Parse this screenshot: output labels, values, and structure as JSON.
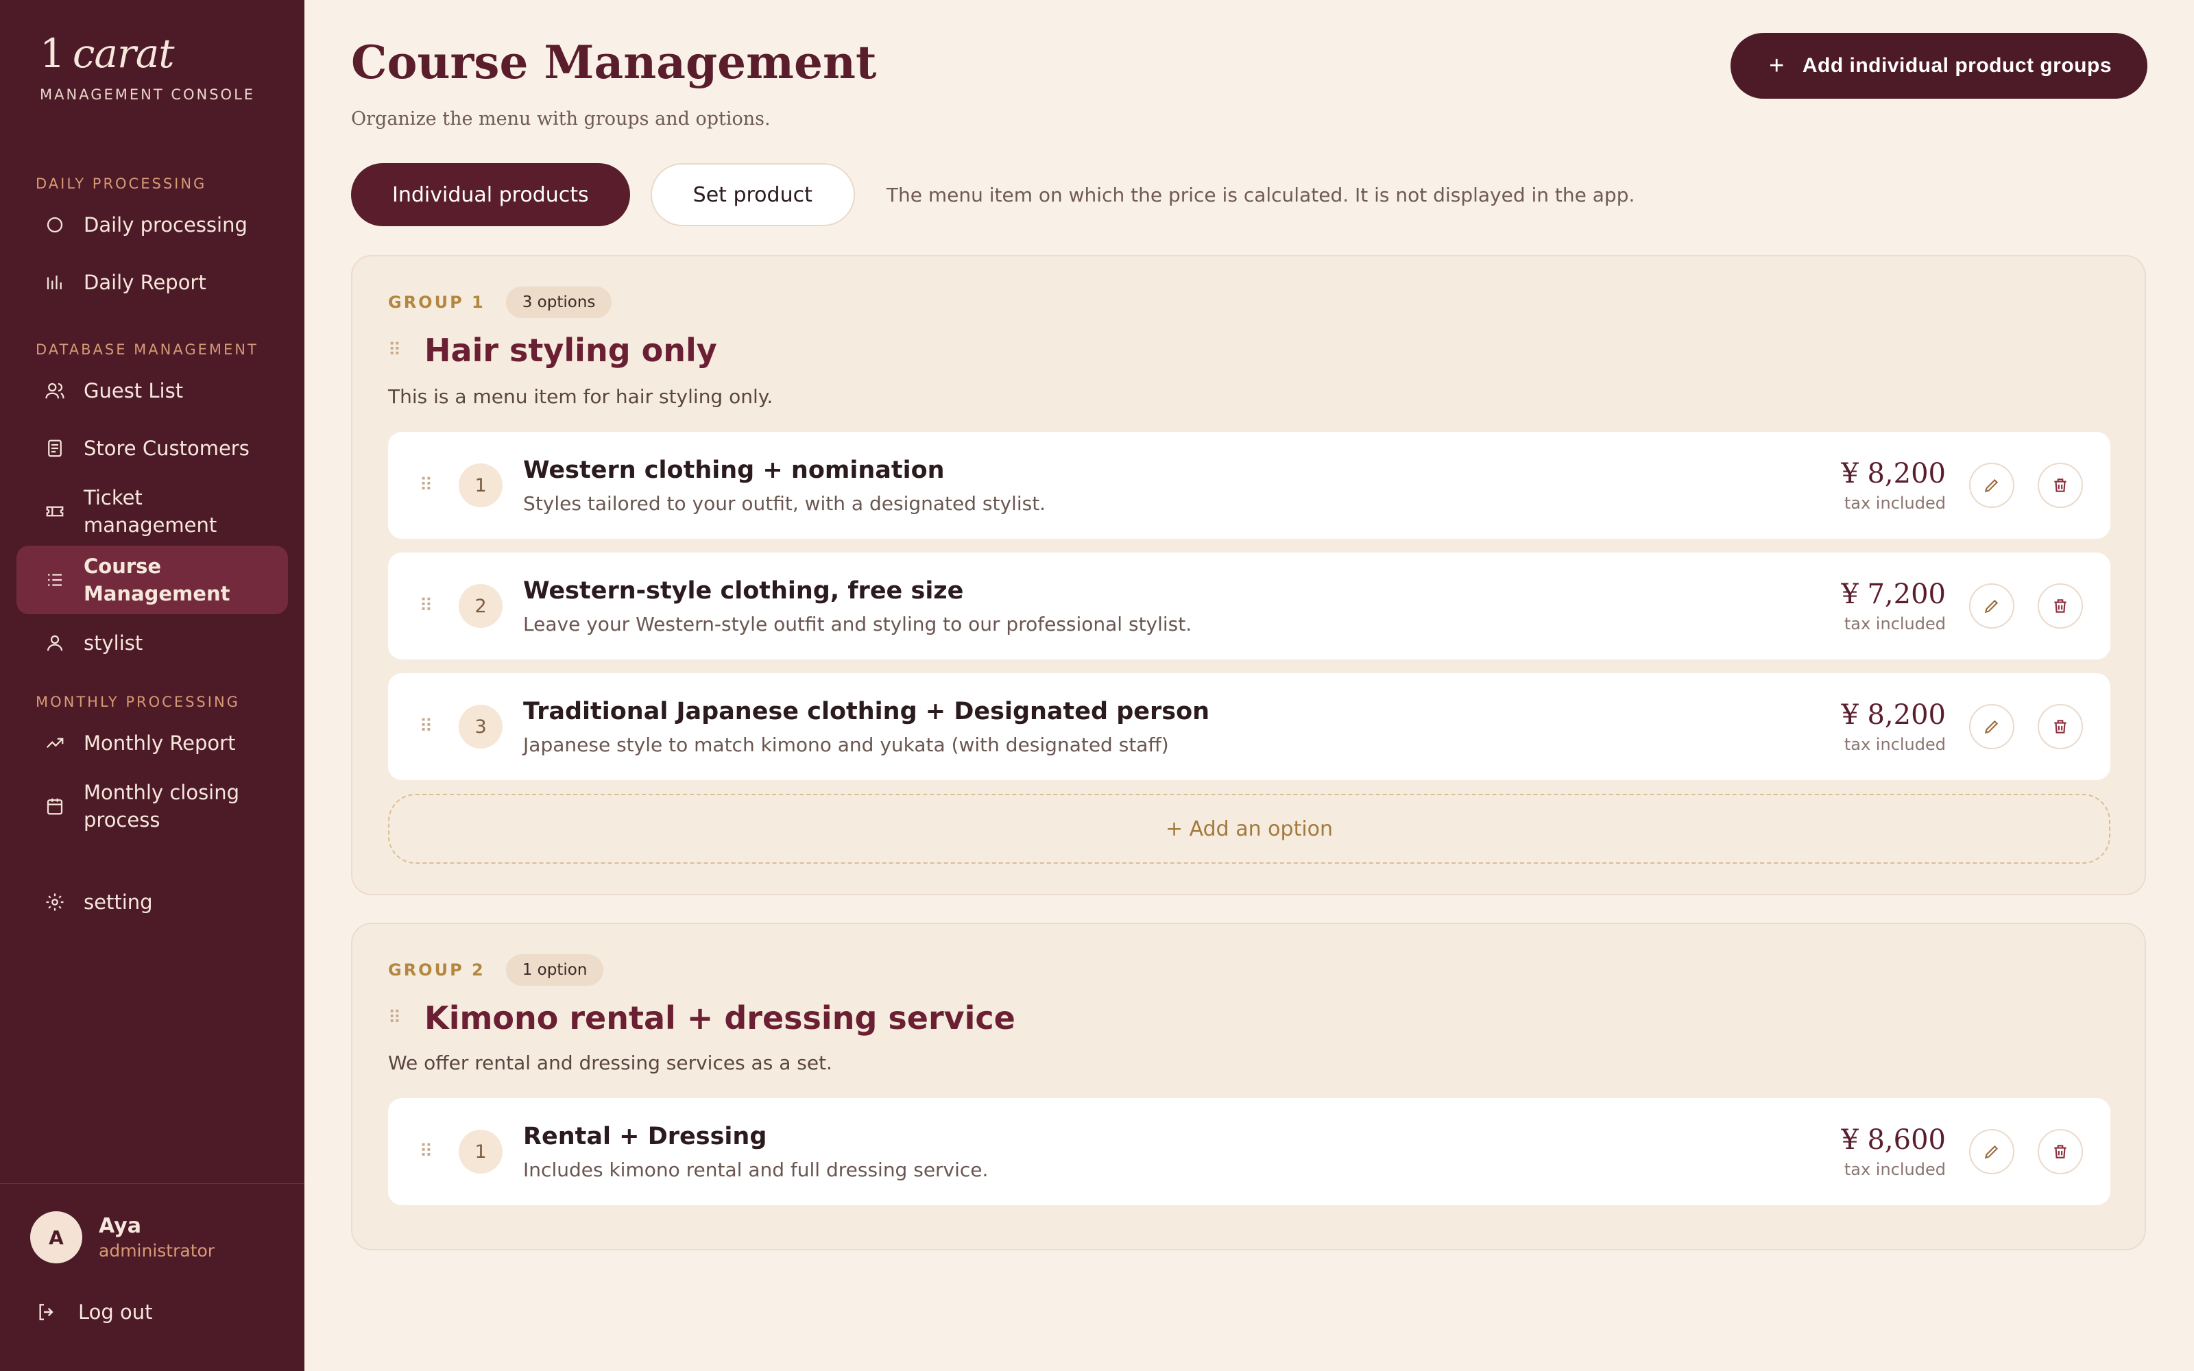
{
  "brand": {
    "logo_number": "1",
    "logo_word": "carat",
    "subtitle": "MANAGEMENT CONSOLE"
  },
  "sidebar": {
    "sections": [
      {
        "title": "DAILY PROCESSING",
        "items": [
          {
            "label": "Daily processing",
            "icon": "circle-icon"
          },
          {
            "label": "Daily Report",
            "icon": "bar-chart-icon"
          }
        ]
      },
      {
        "title": "DATABASE MANAGEMENT",
        "items": [
          {
            "label": "Guest List",
            "icon": "users-icon"
          },
          {
            "label": "Store Customers",
            "icon": "document-icon"
          },
          {
            "label": "Ticket management",
            "icon": "ticket-icon"
          },
          {
            "label": "Course Management",
            "icon": "list-icon",
            "active": true
          },
          {
            "label": "stylist",
            "icon": "user-icon"
          }
        ]
      },
      {
        "title": "MONTHLY PROCESSING",
        "items": [
          {
            "label": "Monthly Report",
            "icon": "trend-icon"
          },
          {
            "label": "Monthly closing process",
            "icon": "calendar-icon"
          }
        ]
      }
    ],
    "settings_label": "setting",
    "user": {
      "initial": "A",
      "name": "Aya",
      "role": "administrator"
    },
    "logout_label": "Log out"
  },
  "header": {
    "title": "Course Management",
    "subtitle": "Organize the menu with groups and options.",
    "add_button_label": "Add individual product groups"
  },
  "tabs": {
    "items": [
      "Individual products",
      "Set product"
    ],
    "active": 0,
    "hint": "The menu item on which the price is calculated. It is not displayed in the app."
  },
  "groups": [
    {
      "label": "GROUP 1",
      "badge": "3 options",
      "title": "Hair styling only",
      "description": "This is a menu item for hair styling only.",
      "options": [
        {
          "num": "1",
          "title": "Western clothing + nomination",
          "desc": "Styles tailored to your outfit, with a designated stylist.",
          "price": "¥ 8,200",
          "tax": "tax included"
        },
        {
          "num": "2",
          "title": "Western-style clothing, free size",
          "desc": "Leave your Western-style outfit and styling to our professional stylist.",
          "price": "¥ 7,200",
          "tax": "tax included"
        },
        {
          "num": "3",
          "title": "Traditional Japanese clothing + Designated person",
          "desc": "Japanese style to match kimono and yukata (with designated staff)",
          "price": "¥ 8,200",
          "tax": "tax included"
        }
      ],
      "add_option_label": "+ Add an option"
    },
    {
      "label": "GROUP 2",
      "badge": "1 option",
      "title": "Kimono rental + dressing service",
      "description": "We offer rental and dressing services as a set.",
      "options": [
        {
          "num": "1",
          "title": "Rental + Dressing",
          "desc": "Includes kimono rental and full dressing service.",
          "price": "¥ 8,600",
          "tax": "tax included"
        }
      ]
    }
  ],
  "colors": {
    "sidebar_bg": "#4d1a28",
    "active_item_bg": "#722a3c",
    "page_bg": "#f9f1e7",
    "accent_gold": "#b3873f",
    "title_maroon": "#6a1f33"
  }
}
